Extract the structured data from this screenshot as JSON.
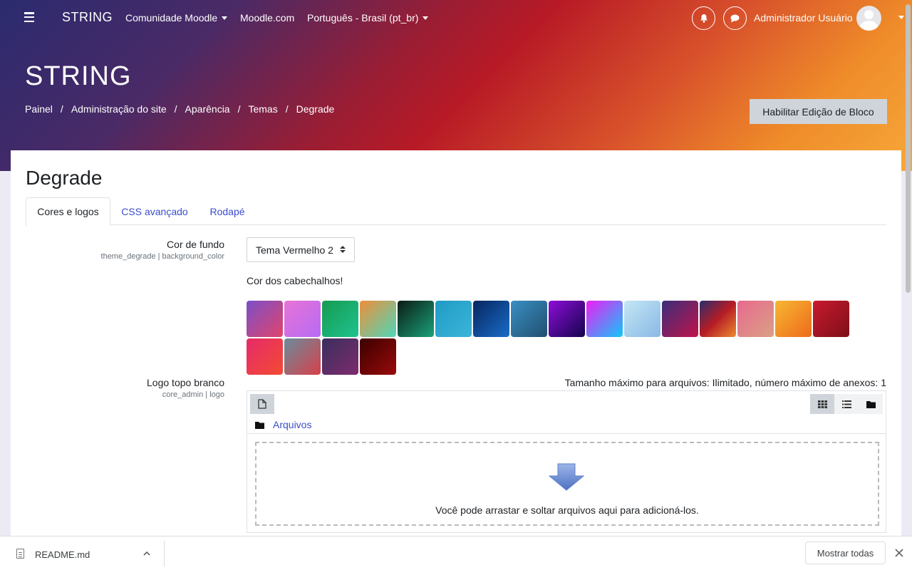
{
  "navbar": {
    "brand": "STRING",
    "items": [
      {
        "label": "Comunidade Moodle",
        "dropdown": true
      },
      {
        "label": "Moodle.com",
        "dropdown": false
      },
      {
        "label": "Português - Brasil (pt_br)",
        "dropdown": true
      }
    ],
    "user_name": "Administrador Usuário"
  },
  "header": {
    "site_title": "STRING",
    "breadcrumb": [
      "Painel",
      "Administração do site",
      "Aparência",
      "Temas",
      "Degrade"
    ],
    "edit_button": "Habilitar Edição de Bloco"
  },
  "page": {
    "heading": "Degrade",
    "tabs": [
      "Cores e logos",
      "CSS avançado",
      "Rodapé"
    ],
    "active_tab": 0
  },
  "settings": {
    "background": {
      "label": "Cor de fundo",
      "sublabel": "theme_degrade | background_color",
      "value": "Tema Vermelho 2",
      "header_colors_label": "Cor dos cabechalhos!",
      "swatches": [
        [
          "#7b4fc9",
          "#e0456b"
        ],
        [
          "#e873d6",
          "#b66bf5"
        ],
        [
          "#169b51",
          "#1fc28f"
        ],
        [
          "#ee8e3a",
          "#4fd7b8"
        ],
        [
          "#0b1b14",
          "#1aa27a"
        ],
        [
          "#1f9bc4",
          "#3cb5d9"
        ],
        [
          "#06265f",
          "#1a6cc8"
        ],
        [
          "#3a8fc3",
          "#204f6f"
        ],
        [
          "#8e0dd9",
          "#12044b"
        ],
        [
          "#f01df5",
          "#0ec8f8"
        ],
        [
          "#c3e7f5",
          "#8ab8e6"
        ],
        [
          "#3b2d7a",
          "#c0144a"
        ],
        [
          "#2c2d6c",
          "#b51c25",
          "#ec8b2d"
        ],
        [
          "#e8698e",
          "#d9a085"
        ],
        [
          "#f7b733",
          "#ee6a1a"
        ],
        [
          "#c71b2d",
          "#7f0e1a"
        ],
        [
          "#e62b6a",
          "#f34a32"
        ],
        [
          "#6a8c9c",
          "#d8404a"
        ],
        [
          "#3a2f5e",
          "#7e2b6d"
        ],
        [
          "#3b0000",
          "#9a0a0a"
        ]
      ]
    },
    "logo": {
      "label": "Logo topo branco",
      "sublabel": "core_admin | logo",
      "file_info": "Tamanho máximo para arquivos: Ilimitado, número máximo de anexos: 1",
      "path_label": "Arquivos",
      "drop_text": "Você pode arrastar e soltar arquivos aqui para adicioná-los."
    }
  },
  "downloads": {
    "file_name": "README.md",
    "show_all": "Mostrar todas"
  }
}
